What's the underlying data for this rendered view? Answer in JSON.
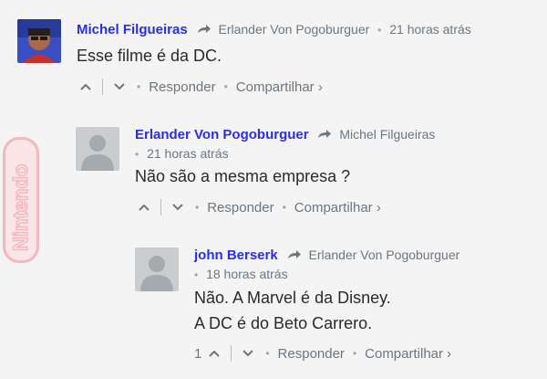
{
  "watermark": {
    "text": "Nintendo",
    "color": "#f2b9bd"
  },
  "colors": {
    "author": "#2a2ee8",
    "meta": "#6a7780",
    "body": "#2a2a2a"
  },
  "comments": [
    {
      "author": "Michel Filgueiras",
      "replying_to": "Erlander Von Pogoburguer",
      "time": "21 horas atrás",
      "text_lines": [
        "Esse filme é da DC."
      ],
      "vote_count": "",
      "actions": {
        "reply": "Responder",
        "share": "Compartilhar ›"
      }
    },
    {
      "author": "Erlander Von Pogoburguer",
      "replying_to": "Michel Filgueiras",
      "time": "21 horas atrás",
      "text_lines": [
        "Não são a mesma empresa ?"
      ],
      "vote_count": "",
      "actions": {
        "reply": "Responder",
        "share": "Compartilhar ›"
      }
    },
    {
      "author": "john Berserk",
      "replying_to": "Erlander Von Pogoburguer",
      "time": "18 horas atrás",
      "text_lines": [
        "Não. A Marvel é da Disney.",
        "A DC é do Beto Carrero."
      ],
      "vote_count": "1",
      "actions": {
        "reply": "Responder",
        "share": "Compartilhar ›"
      }
    }
  ]
}
